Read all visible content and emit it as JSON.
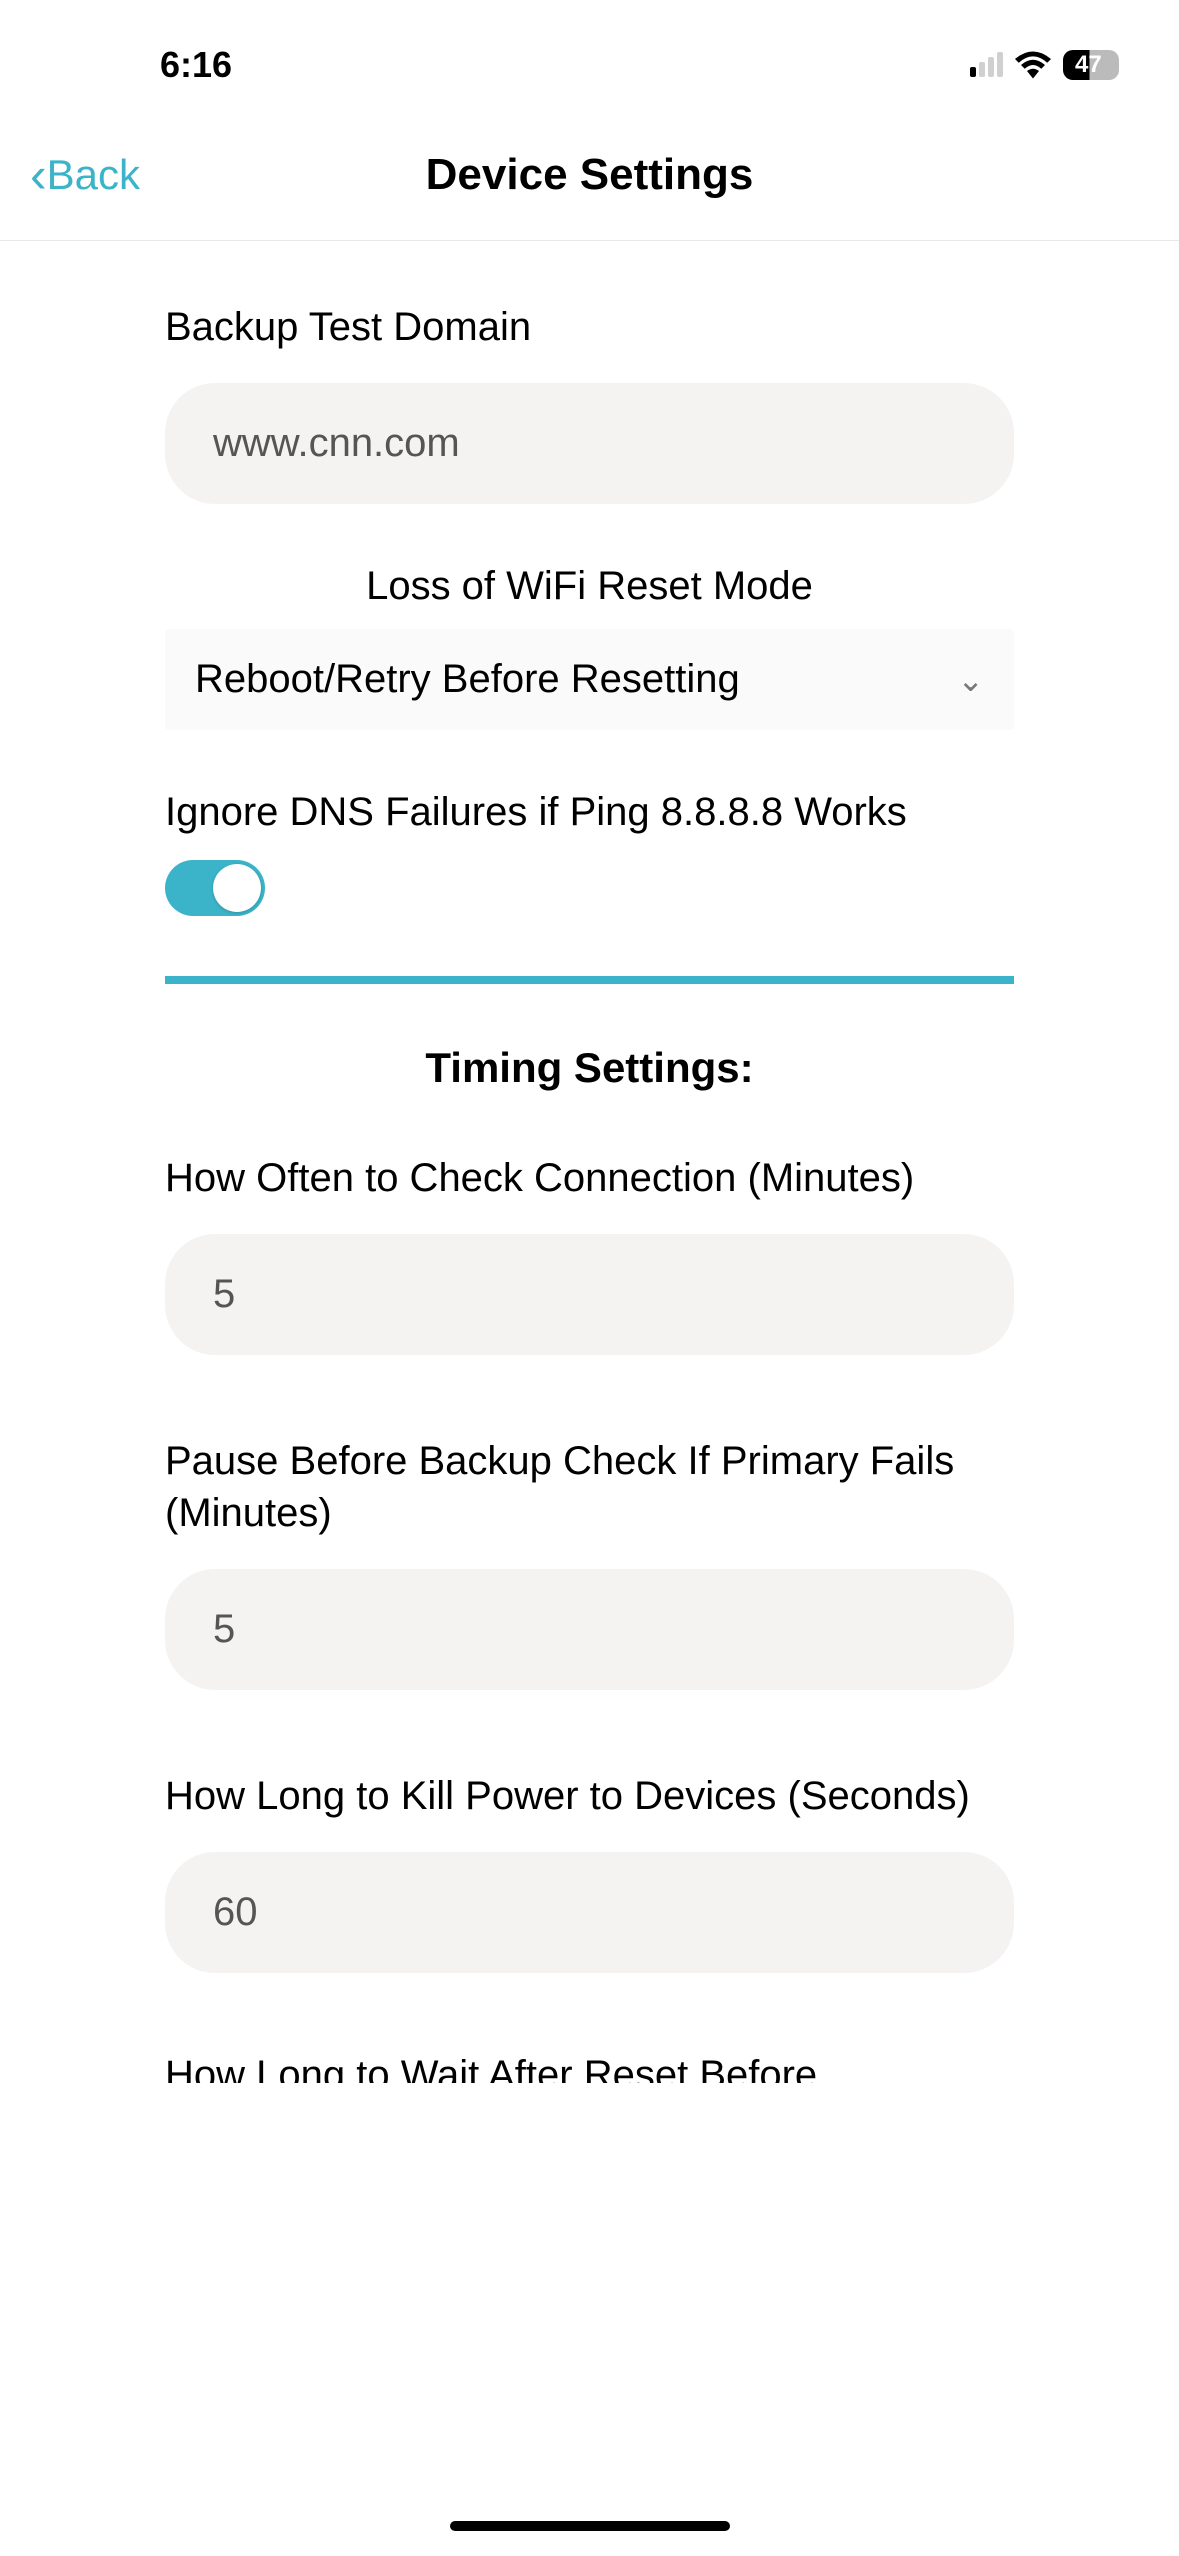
{
  "status": {
    "time": "6:16",
    "battery": "47"
  },
  "nav": {
    "back_label": "Back",
    "title": "Device Settings"
  },
  "settings": {
    "backup_domain": {
      "label": "Backup Test Domain",
      "value": "www.cnn.com"
    },
    "wifi_reset": {
      "label": "Loss of WiFi Reset Mode",
      "value": "Reboot/Retry Before Resetting"
    },
    "ignore_dns": {
      "label": "Ignore DNS Failures if Ping 8.8.8.8 Works",
      "enabled": true
    },
    "timing_section": "Timing Settings:",
    "check_frequency": {
      "label": "How Often to Check Connection (Minutes)",
      "value": "5"
    },
    "pause_backup": {
      "label": "Pause Before Backup Check If Primary Fails (Minutes)",
      "value": "5"
    },
    "kill_power": {
      "label": "How Long to Kill Power to Devices (Seconds)",
      "value": "60"
    },
    "partial_next": "How Long to Wait After Reset Before"
  }
}
